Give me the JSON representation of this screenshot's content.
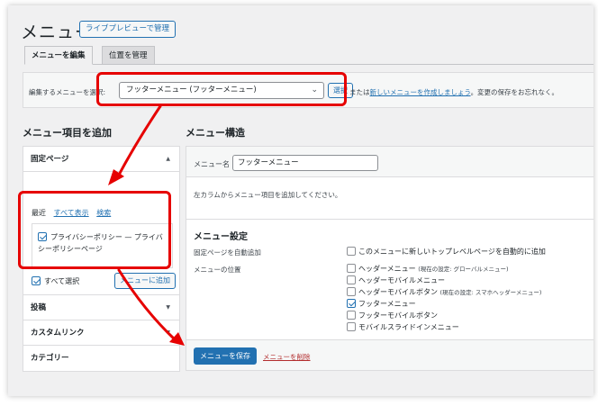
{
  "header": {
    "title": "メニュー",
    "live_preview_button": "ライブプレビューで管理"
  },
  "tabs": [
    {
      "label": "メニューを編集"
    },
    {
      "label": "位置を管理"
    }
  ],
  "select_bar": {
    "label": "編集するメニューを選択:",
    "selected_menu": "フッターメニュー (フッターメニュー)",
    "select_button": "選択",
    "text_before_link": "または",
    "create_link": "新しいメニューを作成しましょう",
    "text_after_link": "。変更の保存をお忘れなく。"
  },
  "add_items": {
    "title": "メニュー項目を追加",
    "sections": [
      {
        "label": "固定ページ"
      },
      {
        "label": "投稿"
      },
      {
        "label": "カスタムリンク"
      },
      {
        "label": "カテゴリー"
      }
    ],
    "inner_tabs": [
      "最近",
      "すべて表示",
      "検索"
    ],
    "list_item": "プライバシーポリシー — プライバシーポリシーページ",
    "select_all": "すべて選択",
    "add_button": "メニューに追加"
  },
  "structure": {
    "title": "メニュー構造",
    "menu_name_label": "メニュー名",
    "menu_name_value": "フッターメニュー",
    "hint": "左カラムからメニュー項目を追加してください。",
    "settings_title": "メニュー設定",
    "auto_add_label": "固定ページを自動追加",
    "auto_add_option": "このメニューに新しいトップレベルページを自動的に追加",
    "location_label": "メニューの位置",
    "locations": [
      {
        "label": "ヘッダーメニュー",
        "note": "(現在の設定: グローバルメニュー)",
        "checked": false
      },
      {
        "label": "ヘッダーモバイルメニュー",
        "note": "",
        "checked": false
      },
      {
        "label": "ヘッダーモバイルボタン",
        "note": "(現在の設定: スマホヘッダーメニュー)",
        "checked": false
      },
      {
        "label": "フッターメニュー",
        "note": "",
        "checked": true
      },
      {
        "label": "フッターモバイルボタン",
        "note": "",
        "checked": false
      },
      {
        "label": "モバイルスライドインメニュー",
        "note": "",
        "checked": false
      }
    ],
    "save_button": "メニューを保存",
    "delete_link": "メニューを削除"
  },
  "colors": {
    "highlight": "#e60000",
    "accent": "#2271b1"
  }
}
